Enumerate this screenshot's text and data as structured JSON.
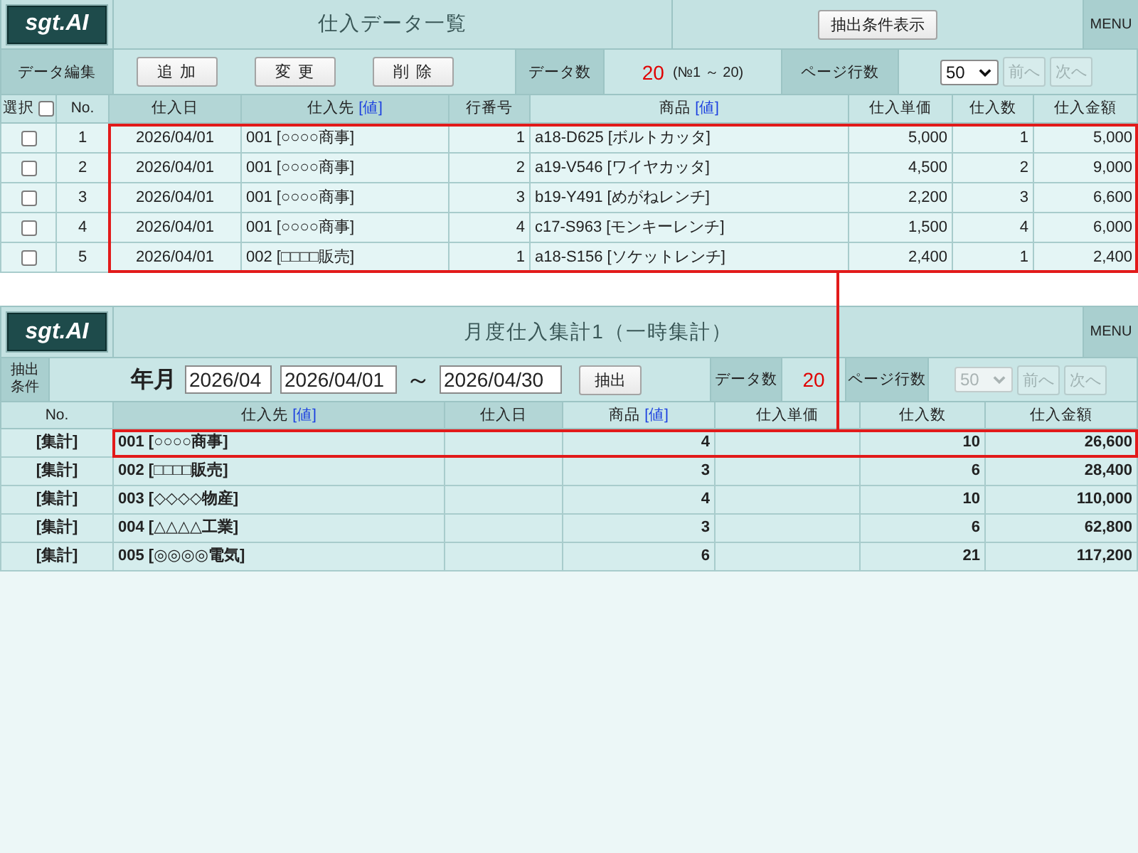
{
  "list_screen": {
    "logo": "sgt.AI",
    "title": "仕入データ一覧",
    "show_filter_button": "抽出条件表示",
    "menu": "MENU",
    "toolbar": {
      "label": "データ編集",
      "buttons": [
        "追 加",
        "変 更",
        "削 除"
      ],
      "count_label": "データ数",
      "count": "20",
      "range": "(№1 ～ 20)",
      "page_rows_label": "ページ行数",
      "page_rows": {
        "value": "50",
        "disabled": false
      },
      "prev": {
        "label": "前へ",
        "disabled": true
      },
      "next": {
        "label": "次へ",
        "disabled": true
      }
    },
    "table": {
      "select_all": {
        "label": "選択",
        "checked": false
      },
      "columns": [
        {
          "label": "No.",
          "highlighted": false
        },
        {
          "label": "仕入日",
          "highlighted": true
        },
        {
          "label": "仕入先",
          "link": "[値]",
          "highlighted": true
        },
        {
          "label": "行番号",
          "highlighted": true
        },
        {
          "label": "商品",
          "link": "[値]",
          "highlighted": false
        },
        {
          "label": "仕入単価",
          "highlighted": false
        },
        {
          "label": "仕入数",
          "highlighted": false
        },
        {
          "label": "仕入金額",
          "highlighted": false
        }
      ],
      "rows": [
        {
          "checked": false,
          "outlined": true,
          "no": "1",
          "date": "2026/04/01",
          "supplier": "001 [○○○○商事]",
          "line_no": "1",
          "product": "a18-D625 [ボルトカッタ]",
          "unit_price": "5,000",
          "quantity": "1",
          "amount": "5,000"
        },
        {
          "checked": false,
          "outlined": true,
          "no": "2",
          "date": "2026/04/01",
          "supplier": "001 [○○○○商事]",
          "line_no": "2",
          "product": "a19-V546 [ワイヤカッタ]",
          "unit_price": "4,500",
          "quantity": "2",
          "amount": "9,000"
        },
        {
          "checked": false,
          "outlined": true,
          "no": "3",
          "date": "2026/04/01",
          "supplier": "001 [○○○○商事]",
          "line_no": "3",
          "product": "b19-Y491 [めがねレンチ]",
          "unit_price": "2,200",
          "quantity": "3",
          "amount": "6,600"
        },
        {
          "checked": false,
          "outlined": true,
          "no": "4",
          "date": "2026/04/01",
          "supplier": "001 [○○○○商事]",
          "line_no": "4",
          "product": "c17-S963 [モンキーレンチ]",
          "unit_price": "1,500",
          "quantity": "4",
          "amount": "6,000"
        },
        {
          "checked": false,
          "outlined": true,
          "no": "5",
          "date": "2026/04/01",
          "supplier": "002 [□□□□販売]",
          "line_no": "1",
          "product": "a18-S156 [ソケットレンチ]",
          "unit_price": "2,400",
          "quantity": "1",
          "amount": "2,400"
        }
      ]
    }
  },
  "summary_screen": {
    "logo": "sgt.AI",
    "title": "月度仕入集計1（一時集計）",
    "menu": "MENU",
    "filter": {
      "label": "抽出条件",
      "month_label": "年月",
      "month": "2026/04",
      "date_from": "2026/04/01",
      "separator": "～",
      "date_to": "2026/04/30",
      "button": "抽出"
    },
    "count_label": "データ数",
    "count": "20",
    "page_rows_label": "ページ行数",
    "page_rows": {
      "value": "50",
      "disabled": true
    },
    "prev": {
      "label": "前へ",
      "disabled": true
    },
    "next": {
      "label": "次へ",
      "disabled": true
    },
    "table": {
      "columns": [
        {
          "label": "No.",
          "highlighted": false
        },
        {
          "label": "仕入先",
          "link": "[値]",
          "highlighted": true
        },
        {
          "label": "仕入日",
          "highlighted": true
        },
        {
          "label": "商品",
          "link": "[値]",
          "highlighted": false
        },
        {
          "label": "仕入単価",
          "highlighted": false
        },
        {
          "label": "仕入数",
          "highlighted": false
        },
        {
          "label": "仕入金額",
          "highlighted": false
        }
      ],
      "rows": [
        {
          "outlined": true,
          "no": "[集計]",
          "supplier": "001 [○○○○商事]",
          "products": "4",
          "quantity": "10",
          "amount": "26,600"
        },
        {
          "outlined": false,
          "no": "[集計]",
          "supplier": "002 [□□□□販売]",
          "products": "3",
          "quantity": "6",
          "amount": "28,400"
        },
        {
          "outlined": false,
          "no": "[集計]",
          "supplier": "003 [◇◇◇◇物産]",
          "products": "4",
          "quantity": "10",
          "amount": "110,000"
        },
        {
          "outlined": false,
          "no": "[集計]",
          "supplier": "004 [△△△△工業]",
          "products": "3",
          "quantity": "6",
          "amount": "62,800"
        },
        {
          "outlined": false,
          "no": "[集計]",
          "supplier": "005 [◎◎◎◎電気]",
          "products": "6",
          "quantity": "21",
          "amount": "117,200"
        }
      ]
    }
  }
}
